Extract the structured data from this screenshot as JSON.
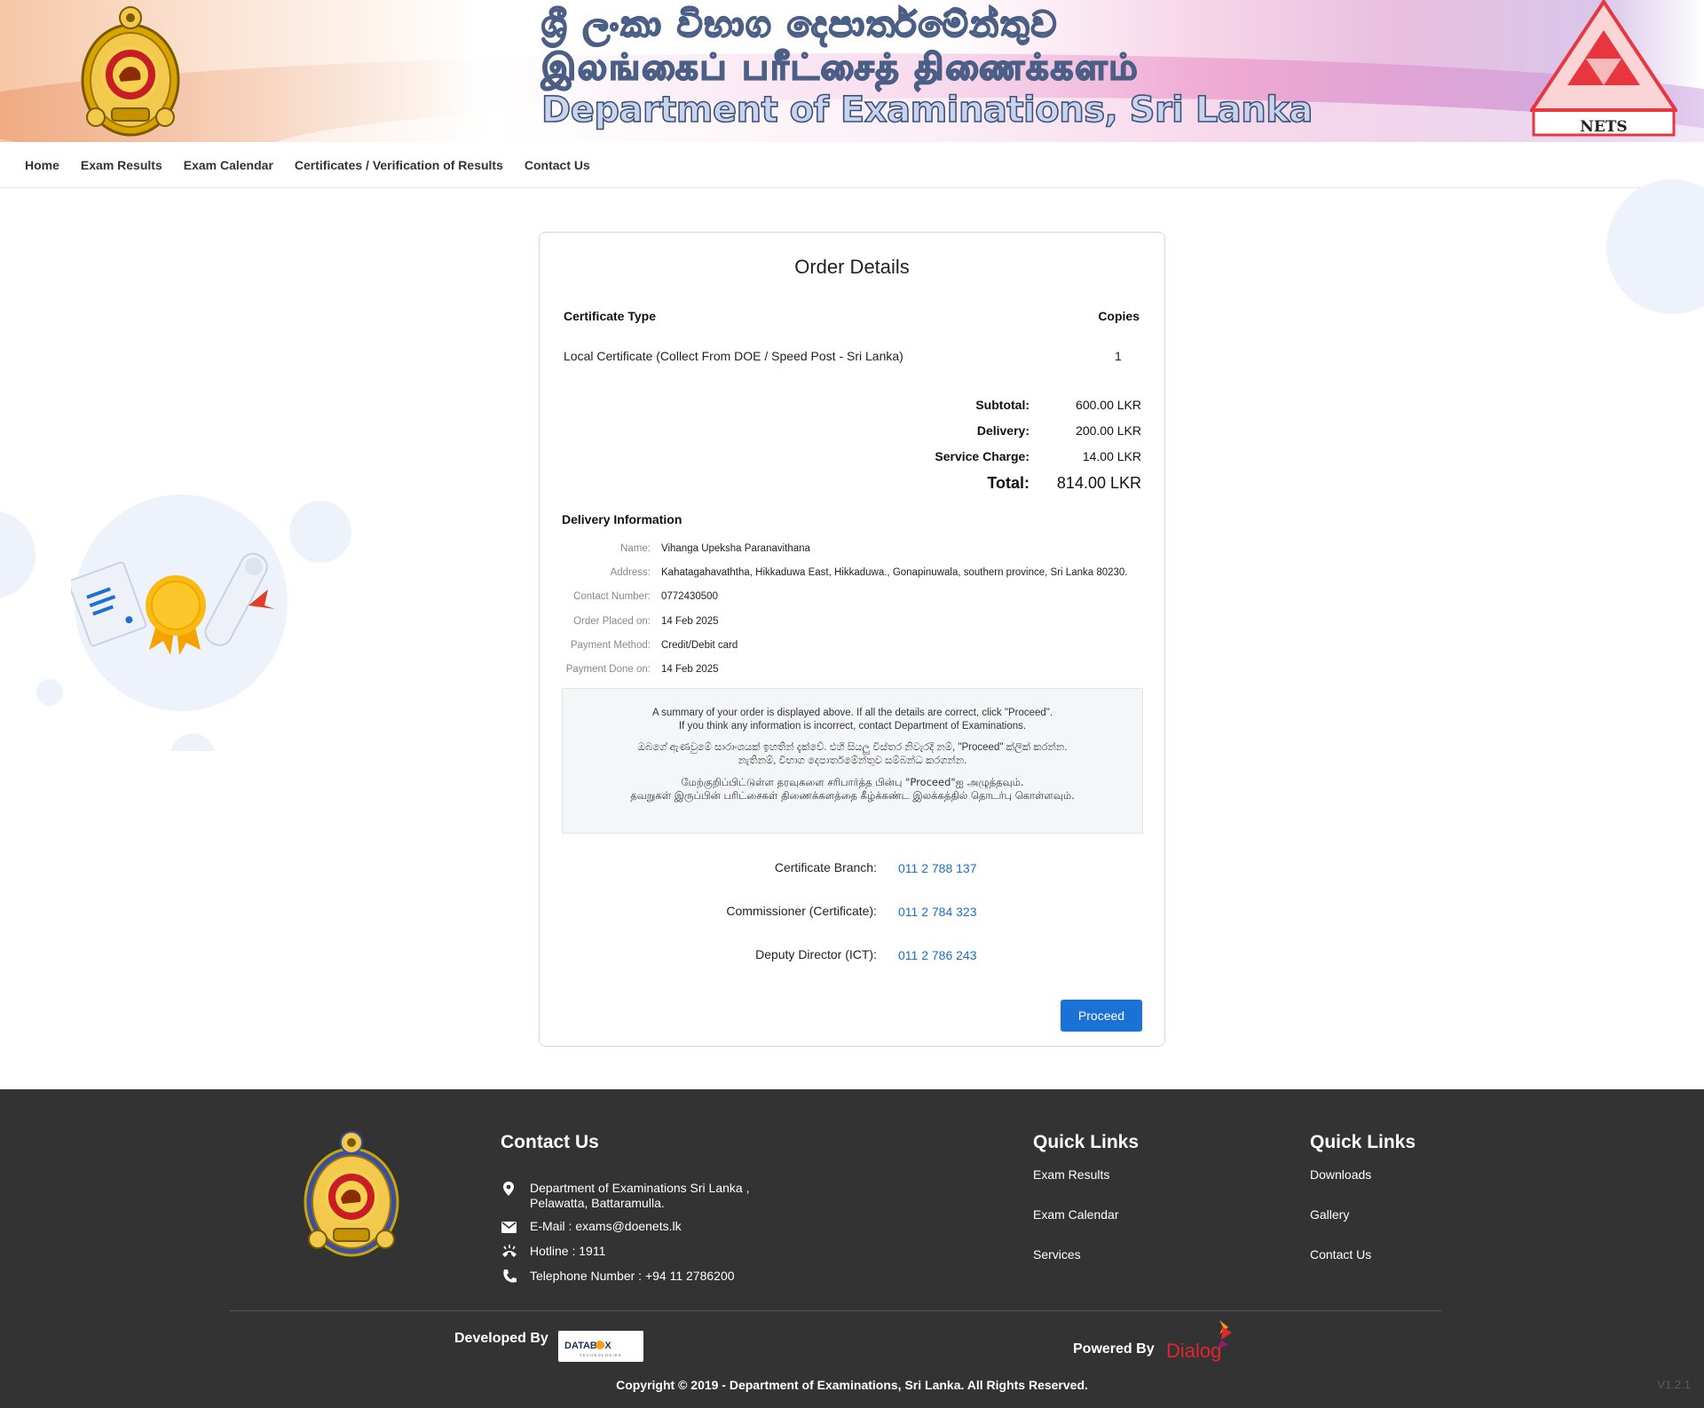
{
  "header": {
    "title_sinhala": "ශ්‍රී ලංකා විභාග දෙපාර්තමේන්තුව",
    "title_tamil": "இலங்கைப் பரீட்சைத் திணைக்களம்",
    "title_english": "Department of Examinations, Sri Lanka",
    "nets_label": "NETS"
  },
  "nav": {
    "items": [
      "Home",
      "Exam Results",
      "Exam Calendar",
      "Certificates / Verification of Results",
      "Contact Us"
    ]
  },
  "order": {
    "title": "Order Details",
    "col_type": "Certificate Type",
    "col_copies": "Copies",
    "item_type": "Local Certificate (Collect From DOE / Speed Post - Sri Lanka)",
    "item_copies": "1",
    "subtotal_label": "Subtotal:",
    "subtotal": "600.00 LKR",
    "delivery_label": "Delivery:",
    "delivery": "200.00 LKR",
    "service_label": "Service Charge:",
    "service": "14.00 LKR",
    "total_label": "Total:",
    "total": "814.00 LKR"
  },
  "delivery": {
    "title": "Delivery Information",
    "name_label": "Name:",
    "name": "Vihanga Upeksha Paranavithana",
    "address_label": "Address:",
    "address": "Kahatagahavaththa, Hikkaduwa East, Hikkaduwa., Gonapinuwala, southern province, Sri Lanka 80230.",
    "contact_label": "Contact Number:",
    "contact": "0772430500",
    "placed_label": "Order Placed on:",
    "placed": "14 Feb 2025",
    "method_label": "Payment Method:",
    "method": "Credit/Debit card",
    "done_label": "Payment Done on:",
    "done": "14 Feb 2025"
  },
  "notice": {
    "en_1": "A summary of your order is displayed above. If all the details are correct, click \"Proceed\".",
    "en_2": "If you think any information is incorrect, contact Department of Examinations.",
    "si_1": "ඔබගේ ඇණවුමේ සාරාංශයක් ඉහතින් දැක්වේ. එහි සියලු විස්තර නිවැරදි නම්, \"Proceed\" ක්ලික් කරන්න.",
    "si_2": "නැතිනම්, විභාග දෙපාර්තමේන්තුව සම්බන්ධ කරගන්න.",
    "ta_1": "மேற்குறிப்பிட்டுள்ள தரவுகளை சரிபார்த்த பின்பு \"Proceed\"ஐ அழுத்தவும்.",
    "ta_2": "தவறுகள் இருப்பின் பரிட்சைகள் திணைக்களத்தை கீழ்க்கண்ட இலக்கத்தில் தொடர்பு கொள்ளவும்."
  },
  "phones": [
    {
      "label": "Certificate Branch:",
      "number": "011 2 788 137"
    },
    {
      "label": "Commissioner (Certificate):",
      "number": "011 2 784 323"
    },
    {
      "label": "Deputy Director (ICT):",
      "number": "011 2 786 243"
    }
  ],
  "proceed_label": "Proceed",
  "footer": {
    "contact_title": "Contact Us",
    "address_1": "Department of Examinations Sri Lanka ,",
    "address_2": "Pelawatta, Battaramulla.",
    "email": "E-Mail : exams@doenets.lk",
    "hotline": "Hotline : 1911",
    "telephone": "Telephone Number : +94 11 2786200",
    "quick1_title": "Quick Links",
    "quick1": [
      "Exam Results",
      "Exam Calendar",
      "Services"
    ],
    "quick2_title": "Quick Links",
    "quick2": [
      "Downloads",
      "Gallery",
      "Contact Us"
    ],
    "developed_by": "Developed By",
    "databox_label": "DATABOX",
    "databox_sub": "TECHNOLOGIES",
    "powered_by": "Powered By",
    "dialog_label": "Dialog",
    "copyright": "Copyright © 2019 - Department of Examinations, Sri Lanka. All Rights Reserved.",
    "version": "V1.2.1"
  },
  "colors": {
    "accent": "#1a73d4",
    "link": "#1a6fc9",
    "footer_bg": "#333333",
    "nets_red": "#e8363f",
    "dialog_red": "#e4252c"
  },
  "icons": [
    "state-emblem-icon",
    "nets-triangle-icon",
    "location-pin-icon",
    "email-icon",
    "hotline-icon",
    "phone-icon",
    "certificate-illustration"
  ]
}
